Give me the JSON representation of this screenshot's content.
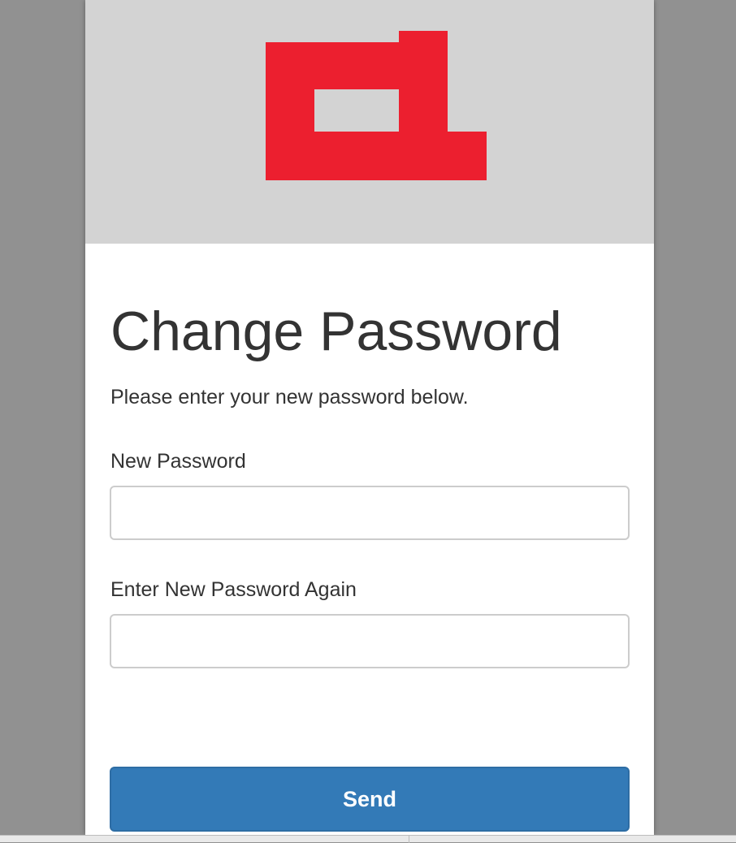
{
  "logo": {
    "icon": "brand-logo",
    "color": "#ec1f2f",
    "background": "#d3d3d3"
  },
  "form": {
    "title": "Change Password",
    "subtitle": "Please enter your new password below.",
    "new_password_label": "New Password",
    "new_password_value": "",
    "confirm_password_label": "Enter New Password Again",
    "confirm_password_value": "",
    "submit_label": "Send"
  },
  "colors": {
    "primary_button": "#337ab7",
    "text": "#333333",
    "backdrop": "#919191"
  }
}
